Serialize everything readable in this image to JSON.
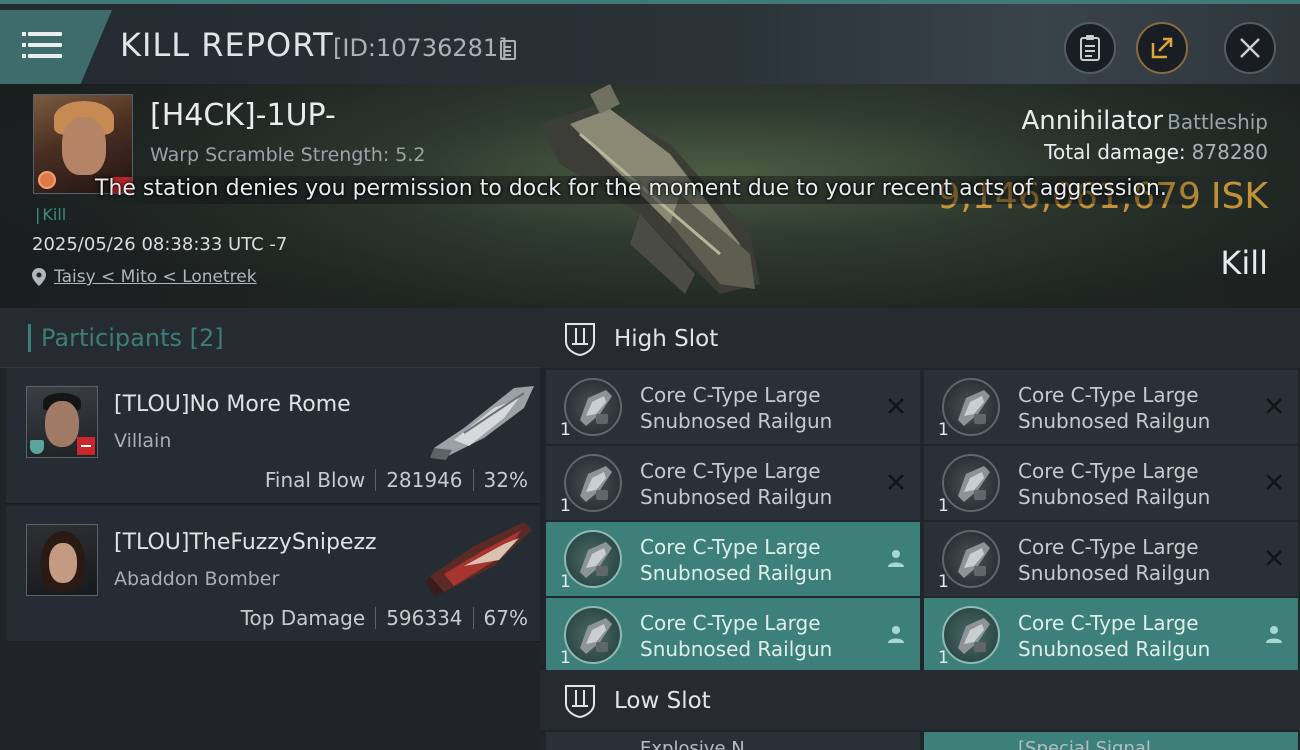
{
  "header": {
    "title": "KILL REPORT",
    "report_id": "[ID:10736281]"
  },
  "victim": {
    "name": "[H4CK]-1UP-",
    "warp_scramble": "Warp Scramble Strength: 5.2",
    "tag": "Kill",
    "timestamp": "2025/05/26 08:38:33 UTC -7",
    "location": "Taisy < Mito < Lonetrek",
    "ship_name": "Annihilator",
    "ship_type": "Battleship",
    "total_damage_label": "Total damage:",
    "total_damage_value": "878280",
    "isk_value": "9,146,061,679",
    "isk_unit": "ISK",
    "result": "Kill"
  },
  "toast": "The station denies you permission to dock for the moment due to your recent acts of aggression.",
  "participants": {
    "label": "Participants",
    "count": "[2]",
    "rows": [
      {
        "name": "[TLOU]No More Rome",
        "ship": "Villain",
        "role": "Final Blow",
        "damage": "281946",
        "percent": "32%"
      },
      {
        "name": "[TLOU]TheFuzzySnipezz",
        "ship": "Abaddon Bomber",
        "role": "Top Damage",
        "damage": "596334",
        "percent": "67%"
      }
    ]
  },
  "slots": {
    "high_label": "High Slot",
    "low_label": "Low Slot",
    "high": [
      {
        "line1": "Core C-Type Large",
        "line2": "Snubnosed Railgun",
        "qty": "1",
        "state": "destroyed"
      },
      {
        "line1": "Core C-Type Large",
        "line2": "Snubnosed Railgun",
        "qty": "1",
        "state": "destroyed"
      },
      {
        "line1": "Core C-Type Large",
        "line2": "Snubnosed Railgun",
        "qty": "1",
        "state": "destroyed"
      },
      {
        "line1": "Core C-Type Large",
        "line2": "Snubnosed Railgun",
        "qty": "1",
        "state": "destroyed"
      },
      {
        "line1": "Core C-Type Large",
        "line2": "Snubnosed Railgun",
        "qty": "1",
        "state": "dropped"
      },
      {
        "line1": "Core C-Type Large",
        "line2": "Snubnosed Railgun",
        "qty": "1",
        "state": "destroyed"
      },
      {
        "line1": "Core C-Type Large",
        "line2": "Snubnosed Railgun",
        "qty": "1",
        "state": "dropped"
      },
      {
        "line1": "Core C-Type Large",
        "line2": "Snubnosed Railgun",
        "qty": "1",
        "state": "dropped"
      }
    ],
    "low_peek": [
      "Explosive N...",
      "[Special Signal..."
    ]
  },
  "colors": {
    "accent_teal": "#3d8079",
    "isk_gold": "#e0a53a",
    "danger_red": "#c8282c"
  },
  "icons": {
    "menu": "menu-icon",
    "clipboard": "clipboard-icon",
    "share": "share-icon",
    "close": "close-icon",
    "location": "location-pin-icon",
    "slot": "slot-shield-icon",
    "destroyed": "x-icon",
    "dropped": "person-icon"
  }
}
